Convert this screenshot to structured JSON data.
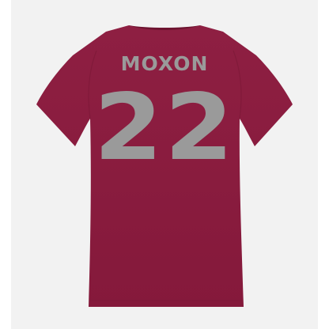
{
  "product": {
    "player_name": "MOXON",
    "player_number": "22",
    "view": "back",
    "garment": "v-neck-t-shirt"
  },
  "colors": {
    "shirt": "#8b1d3f",
    "shirt_shadow": "#7a1836",
    "lettering": "#9a9a9a",
    "background": "#f2f2f2"
  }
}
